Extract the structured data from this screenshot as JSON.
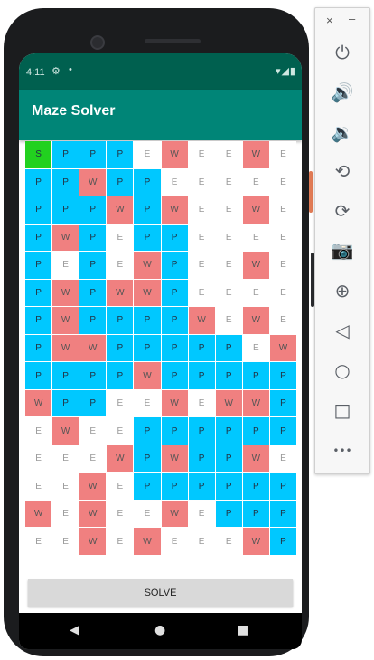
{
  "status_bar": {
    "time": "4:11",
    "settings_icon": "gear-icon",
    "dot": "•",
    "right_icons": "▾◢▮"
  },
  "app": {
    "title": "Maze Solver",
    "solve_label": "SOLVE"
  },
  "maze": {
    "rows": [
      [
        "S",
        "P",
        "P",
        "P",
        "E",
        "W",
        "E",
        "E",
        "W",
        "E"
      ],
      [
        "P",
        "P",
        "W",
        "P",
        "P",
        "E",
        "E",
        "E",
        "E",
        "E"
      ],
      [
        "P",
        "P",
        "P",
        "W",
        "P",
        "W",
        "E",
        "E",
        "W",
        "E"
      ],
      [
        "P",
        "W",
        "P",
        "E",
        "P",
        "P",
        "E",
        "E",
        "E",
        "E"
      ],
      [
        "P",
        "E",
        "P",
        "E",
        "W",
        "P",
        "E",
        "E",
        "W",
        "E"
      ],
      [
        "P",
        "W",
        "P",
        "W",
        "W",
        "P",
        "E",
        "E",
        "E",
        "E"
      ],
      [
        "P",
        "W",
        "P",
        "P",
        "P",
        "P",
        "W",
        "E",
        "W",
        "E"
      ],
      [
        "P",
        "W",
        "W",
        "P",
        "P",
        "P",
        "P",
        "P",
        "E",
        "W"
      ],
      [
        "P",
        "P",
        "P",
        "P",
        "W",
        "P",
        "P",
        "P",
        "P",
        "P"
      ],
      [
        "W",
        "P",
        "P",
        "E",
        "E",
        "W",
        "E",
        "W",
        "W",
        "P"
      ],
      [
        "E",
        "W",
        "E",
        "E",
        "P",
        "P",
        "P",
        "P",
        "P",
        "P"
      ],
      [
        "E",
        "E",
        "E",
        "W",
        "P",
        "W",
        "P",
        "P",
        "W",
        "E"
      ],
      [
        "E",
        "E",
        "W",
        "E",
        "P",
        "P",
        "P",
        "P",
        "P",
        "P"
      ],
      [
        "W",
        "E",
        "W",
        "E",
        "E",
        "W",
        "E",
        "P",
        "P",
        "P"
      ],
      [
        "E",
        "E",
        "W",
        "E",
        "W",
        "E",
        "E",
        "E",
        "W",
        "P"
      ]
    ],
    "colors": {
      "P": "#00c8ff",
      "W": "#f08080",
      "E": "#ffffff",
      "S": "#22d11f"
    }
  },
  "nav": {
    "back_icon": "◀",
    "home_icon": "●",
    "recents_icon": "■"
  },
  "emulator": {
    "close": "×",
    "minimize": "–",
    "buttons": [
      {
        "name": "power-icon",
        "glyph": "⏻"
      },
      {
        "name": "volume-up-icon",
        "glyph": "🔊"
      },
      {
        "name": "volume-down-icon",
        "glyph": "🔉"
      },
      {
        "name": "rotate-left-icon",
        "glyph": "⟲"
      },
      {
        "name": "rotate-right-icon",
        "glyph": "⟳"
      },
      {
        "name": "camera-icon",
        "glyph": "📷"
      },
      {
        "name": "zoom-icon",
        "glyph": "⊕"
      },
      {
        "name": "back-icon",
        "glyph": "◁"
      },
      {
        "name": "home-icon",
        "glyph": "○"
      },
      {
        "name": "overview-icon",
        "glyph": "□"
      },
      {
        "name": "more-icon",
        "glyph": "•••"
      }
    ]
  }
}
